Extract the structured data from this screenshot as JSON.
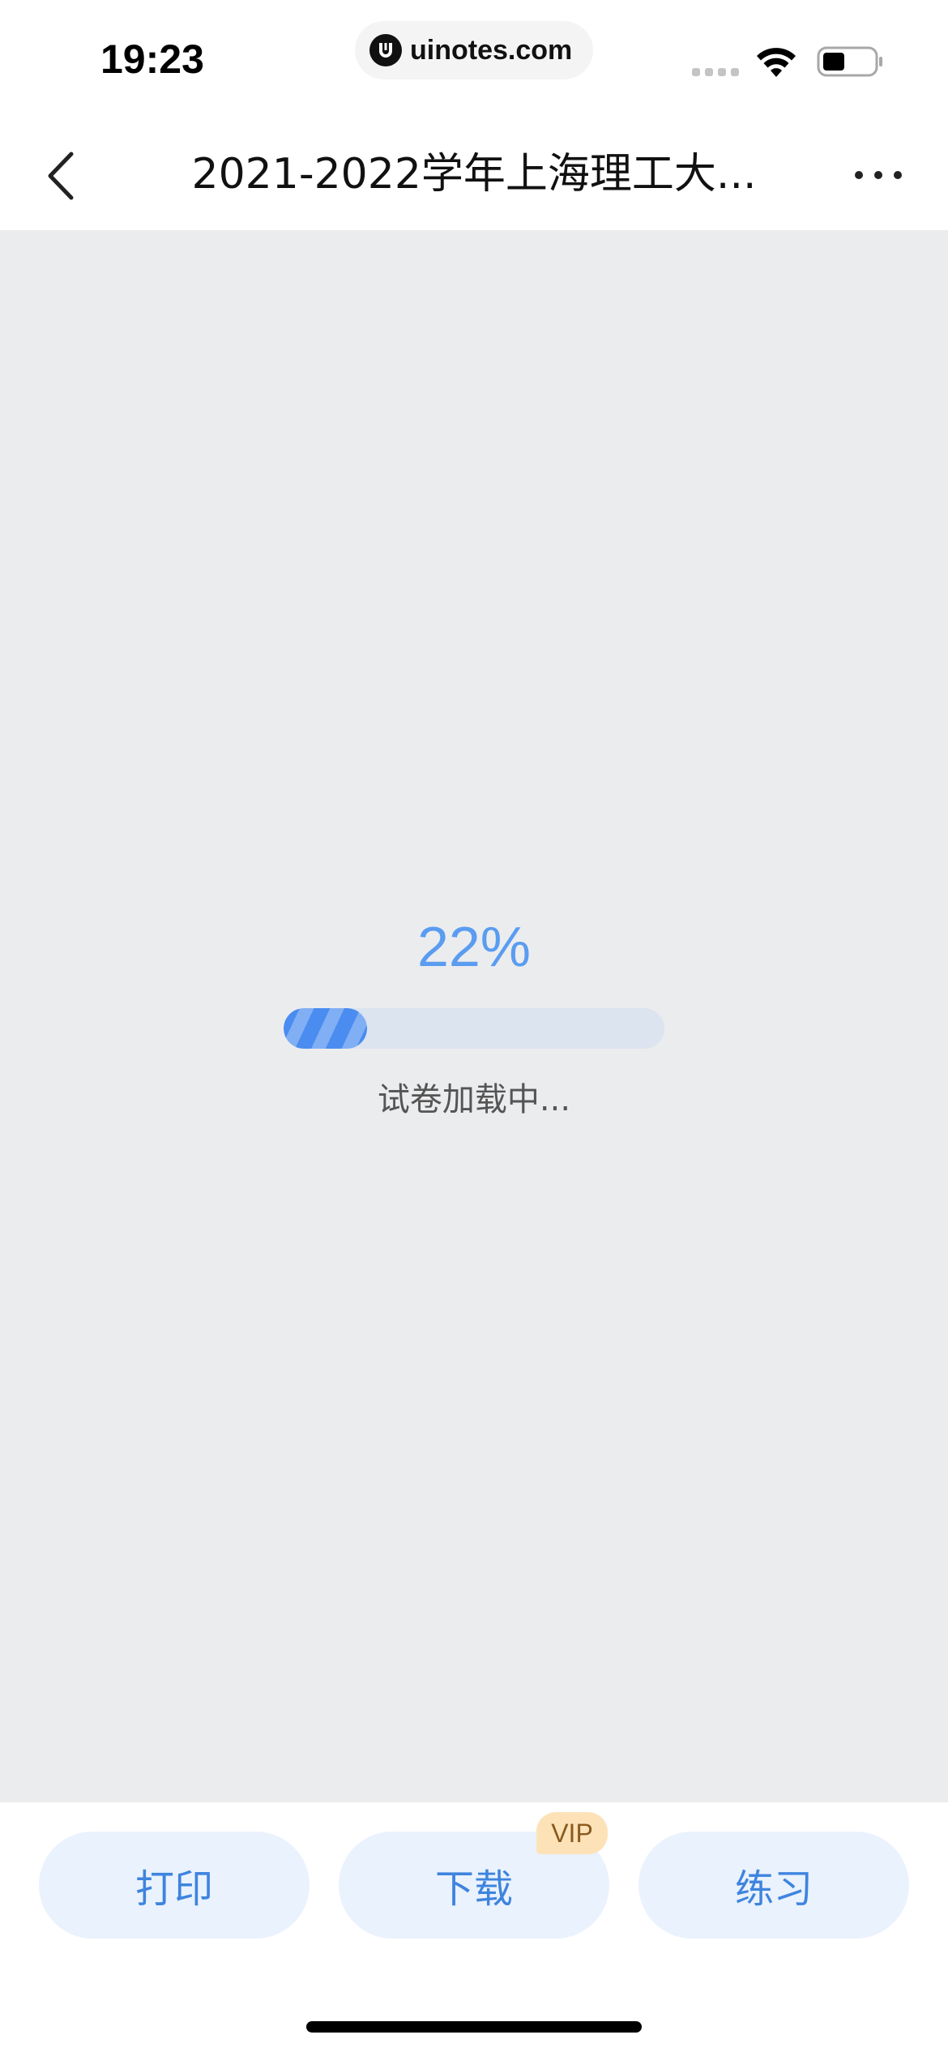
{
  "status_bar": {
    "time": "19:23",
    "url": "uinotes.com",
    "icons": [
      "signal-icon",
      "wifi-icon",
      "battery-icon"
    ]
  },
  "nav": {
    "title": "2021-2022学年上海理工大...",
    "icons": [
      "back-icon",
      "more-icon"
    ]
  },
  "loading": {
    "percent_text": "22%",
    "progress": 0.22,
    "message": "试卷加载中..."
  },
  "actions": {
    "print_label": "打印",
    "download_label": "下载",
    "vip_badge": "VIP",
    "practice_label": "练习"
  },
  "colors": {
    "accent": "#4a8cf0",
    "button_bg": "#eaf2fd",
    "content_bg": "#ebecee",
    "vip_bg": "#fde2b8"
  }
}
